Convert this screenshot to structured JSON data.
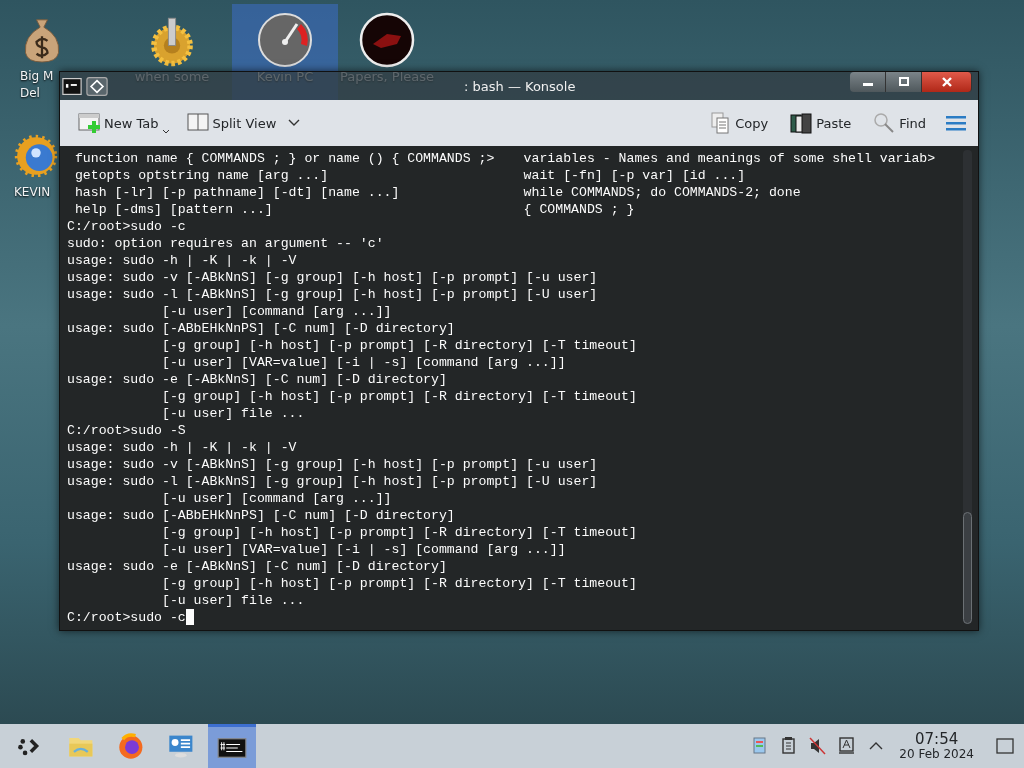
{
  "desktop_icons": [
    {
      "kind": "money",
      "lines": [
        "Big M",
        "Del"
      ],
      "selected": false
    },
    {
      "kind": "gear",
      "lines": [
        "when some"
      ],
      "selected": false
    },
    {
      "kind": "gauge",
      "lines": [
        "Kevin PC"
      ],
      "selected": true
    },
    {
      "kind": "redcircle",
      "lines": [
        "Papers, Please"
      ],
      "selected": false
    },
    {
      "kind": "sun",
      "lines": [
        "KEVIN"
      ],
      "selected": false
    }
  ],
  "window": {
    "title": ": bash — Konsole"
  },
  "toolbar": {
    "left": [
      {
        "kind": "newtab",
        "label": "New Tab"
      },
      {
        "kind": "split",
        "label": "Split View"
      }
    ],
    "right": [
      {
        "kind": "copy",
        "label": "Copy"
      },
      {
        "kind": "paste",
        "label": "Paste"
      },
      {
        "kind": "find",
        "label": "Find"
      }
    ]
  },
  "terminal": {
    "columns": [
      [
        "function name { COMMANDS ; } or name () { COMMANDS ;>",
        "variables - Names and meanings of some shell variab>"
      ],
      [
        "getopts optstring name [arg ...]",
        "wait [-fn] [-p var] [id ...]"
      ],
      [
        "hash [-lr] [-p pathname] [-dt] [name ...]",
        "while COMMANDS; do COMMANDS-2; done"
      ],
      [
        "help [-dms] [pattern ...]",
        "{ COMMANDS ; }"
      ]
    ],
    "lines": [
      "C:/root>sudo -c",
      "sudo: option requires an argument -- 'c'",
      "usage: sudo -h | -K | -k | -V",
      "usage: sudo -v [-ABkNnS] [-g group] [-h host] [-p prompt] [-u user]",
      "usage: sudo -l [-ABkNnS] [-g group] [-h host] [-p prompt] [-U user]",
      "            [-u user] [command [arg ...]]",
      "usage: sudo [-ABbEHkNnPS] [-C num] [-D directory]",
      "            [-g group] [-h host] [-p prompt] [-R directory] [-T timeout]",
      "            [-u user] [VAR=value] [-i | -s] [command [arg ...]]",
      "usage: sudo -e [-ABkNnS] [-C num] [-D directory]",
      "            [-g group] [-h host] [-p prompt] [-R directory] [-T timeout]",
      "            [-u user] file ...",
      "C:/root>sudo -S",
      "usage: sudo -h | -K | -k | -V",
      "usage: sudo -v [-ABkNnS] [-g group] [-h host] [-p prompt] [-u user]",
      "usage: sudo -l [-ABkNnS] [-g group] [-h host] [-p prompt] [-U user]",
      "            [-u user] [command [arg ...]]",
      "usage: sudo [-ABbEHkNnPS] [-C num] [-D directory]",
      "            [-g group] [-h host] [-p prompt] [-R directory] [-T timeout]",
      "            [-u user] [VAR=value] [-i | -s] [command [arg ...]]",
      "usage: sudo -e [-ABkNnS] [-C num] [-D directory]",
      "            [-g group] [-h host] [-p prompt] [-R directory] [-T timeout]",
      "            [-u user] file ..."
    ],
    "prompt": "C:/root>sudo -c"
  },
  "taskbar": {
    "apps": [
      {
        "kind": "launcher",
        "selected": false
      },
      {
        "kind": "folder",
        "selected": false
      },
      {
        "kind": "browser",
        "selected": false
      },
      {
        "kind": "monitor",
        "selected": false
      },
      {
        "kind": "terminal",
        "selected": true
      }
    ],
    "tray": [
      {
        "kind": "clipboard"
      },
      {
        "kind": "notes"
      },
      {
        "kind": "muted"
      },
      {
        "kind": "keyboard"
      },
      {
        "kind": "chevron"
      }
    ],
    "time": "07:54",
    "date": "20 Feb 2024"
  }
}
